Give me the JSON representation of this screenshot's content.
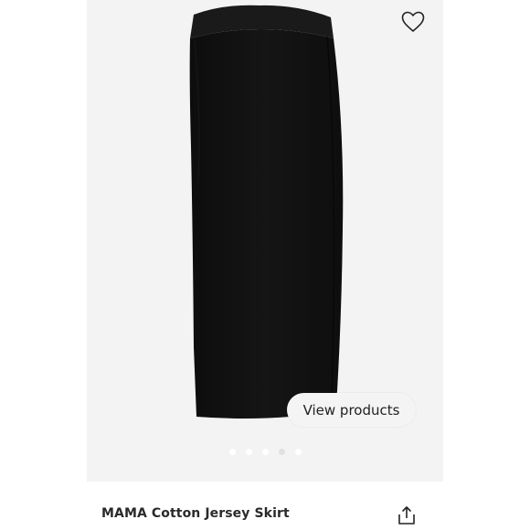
{
  "product": {
    "title": "MAMA Cotton Jersey Skirt",
    "image_subject": "skirt-image",
    "image_color": "#121212"
  },
  "actions": {
    "view_products_label": "View products",
    "favorite_icon": "heart-icon",
    "share_icon": "share-icon"
  },
  "carousel": {
    "total": 5,
    "active_index": 3
  },
  "colors": {
    "background": "#f3f3f3",
    "info_bar": "#ffffff",
    "text": "#2a2a2a"
  }
}
